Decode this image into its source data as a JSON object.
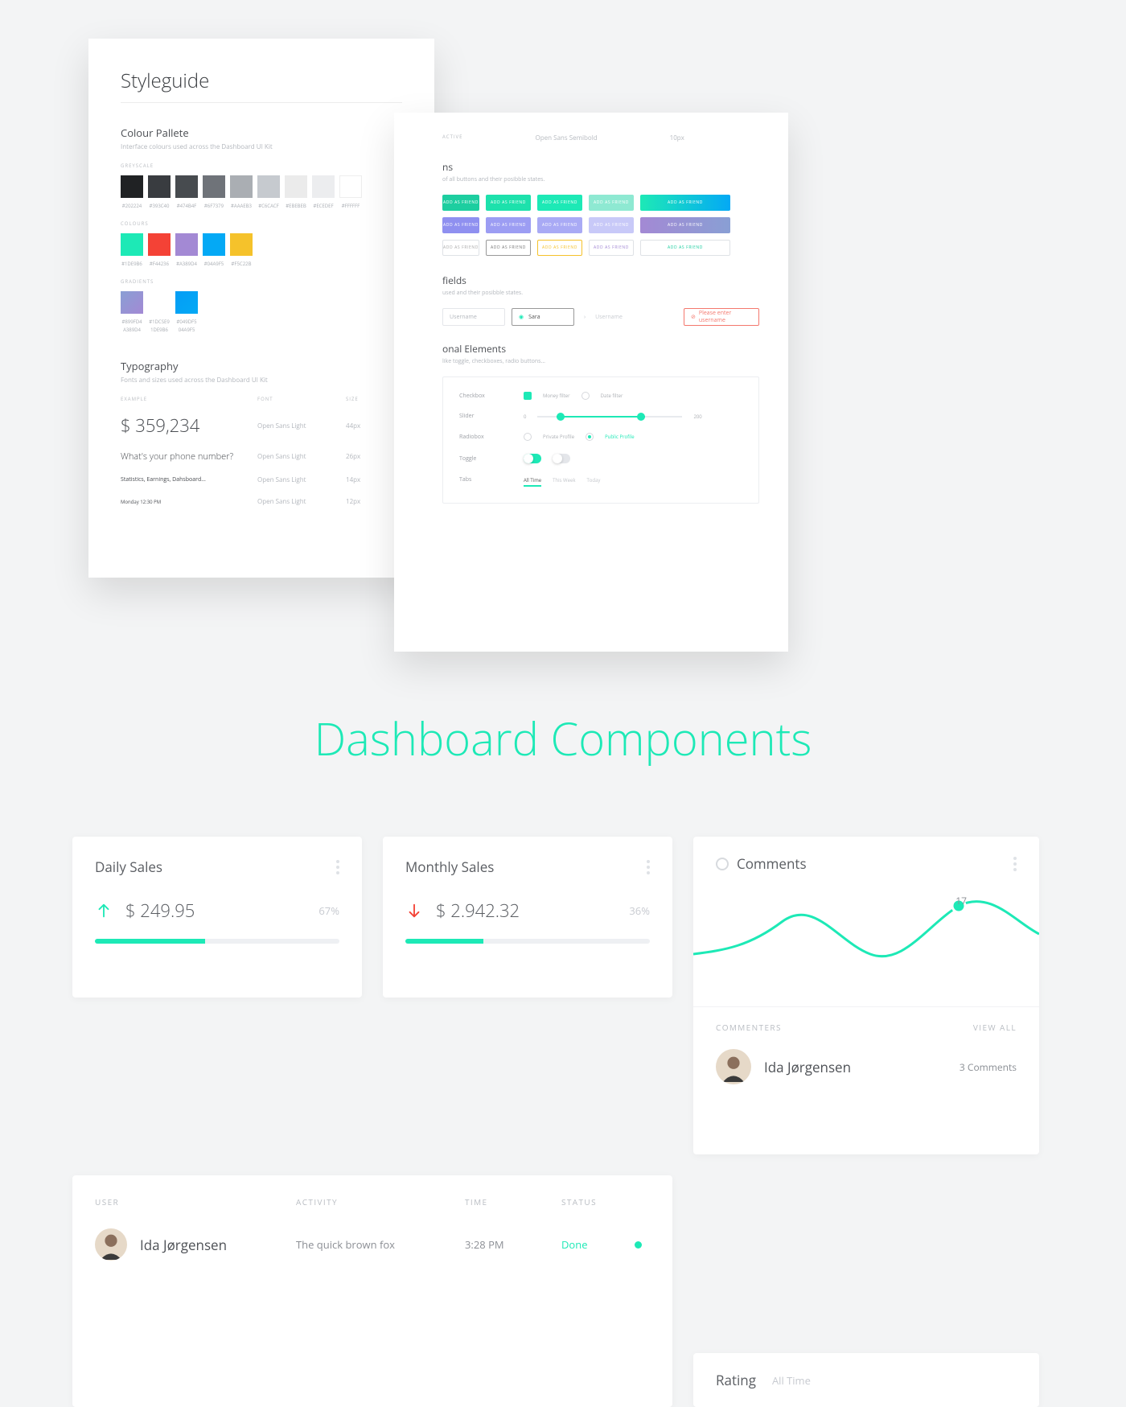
{
  "styleguide": {
    "title": "Styleguide",
    "palette": {
      "heading": "Colour Pallete",
      "sub": "Interface colours used across the Dashboard UI Kit",
      "greyscale_label": "GREYSCALE",
      "greyscale": [
        {
          "hex": "#202224"
        },
        {
          "hex": "#393C40"
        },
        {
          "hex": "#474B4F"
        },
        {
          "hex": "#6F7379"
        },
        {
          "hex": "#AAAEB3"
        },
        {
          "hex": "#C6CACF"
        },
        {
          "hex": "#EBEBEB"
        },
        {
          "hex": "#ECEDEF"
        },
        {
          "hex": "#FFFFFF"
        }
      ],
      "colours_label": "COLOURS",
      "colours": [
        {
          "hex": "#1DE9B6"
        },
        {
          "hex": "#F44236"
        },
        {
          "hex": "#A389D4"
        },
        {
          "hex": "#04A9F5"
        },
        {
          "hex": "#F5C22B"
        }
      ],
      "gradients_label": "GRADIENTS",
      "gradients": [
        {
          "a": "#899FD4",
          "b": "#A389D4",
          "lab1": "#899FD4",
          "lab2": "A389D4"
        },
        {
          "a": "#1DCSE9",
          "b": "#1DE9B6",
          "lab1": "#1DCSE9",
          "lab2": "1DE9B6"
        },
        {
          "a": "#049DF5",
          "b": "#04A9F5",
          "lab1": "#049DF5",
          "lab2": "04A9F5"
        }
      ]
    },
    "typography": {
      "heading": "Typography",
      "sub": "Fonts and sizes used across the Dashboard UI Kit",
      "cols": {
        "example": "EXAMPLE",
        "font": "FONT",
        "size": "SIZE"
      },
      "rows": [
        {
          "example": "$ 359,234",
          "font": "Open Sans Light",
          "size": "44px",
          "fs": "22px",
          "fw": "300"
        },
        {
          "example": "What's your phone number?",
          "font": "Open Sans Light",
          "size": "26px",
          "fs": "11px",
          "fw": "300"
        },
        {
          "example": "Statistics, Earnings, Dahsboard...",
          "font": "Open Sans Light",
          "size": "14px",
          "fs": "7px",
          "fw": "400"
        },
        {
          "example": "Monday 12:30 PM",
          "font": "Open Sans Light",
          "size": "12px",
          "fs": "6px",
          "fw": "400"
        }
      ]
    }
  },
  "sheet": {
    "top": {
      "label": "ACTIVE",
      "font": "Open Sans Semibold",
      "size": "10px"
    },
    "buttons": {
      "heading": "ns",
      "sub": "of all buttons and their posibble states.",
      "label": "ADD AS FRIEND"
    },
    "fields": {
      "heading": "fields",
      "sub": "used and their posibble states.",
      "ph": "Username",
      "val": "Sara",
      "err": "Please enter username"
    },
    "elements": {
      "heading": "onal Elements",
      "sub": "like toggle, checkboxes, radio buttons...",
      "checkbox": "Checkbox",
      "slider": "Slider",
      "radiobox": "Radiobox",
      "toggle": "Toggle",
      "tabs": "Tabs",
      "chk_on": "Money filter",
      "chk_off": "Date filter",
      "rad1": "Private Profile",
      "rad2": "Public Profile",
      "tabs_items": [
        "All Time",
        "This Week",
        "Today"
      ],
      "slider_min": "0",
      "slider_max": "200"
    }
  },
  "headline": "Dashboard Components",
  "daily": {
    "title": "Daily Sales",
    "amount": "$ 249.95",
    "pct": "67%",
    "bar": 45
  },
  "monthly": {
    "title": "Monthly Sales",
    "amount": "$ 2.942.32",
    "pct": "36%",
    "bar": 32
  },
  "comments": {
    "title": "Comments",
    "point": "17",
    "commenters_label": "COMMENTERS",
    "viewall": "VIEW ALL",
    "user": {
      "name": "Ida Jørgensen",
      "count": "3 Comments"
    }
  },
  "table": {
    "cols": {
      "user": "USER",
      "activity": "ACTIVITY",
      "time": "TIME",
      "status": "STATUS"
    },
    "rows": [
      {
        "user": "Ida Jørgensen",
        "activity": "The quick brown fox",
        "time": "3:28 PM",
        "status": "Done"
      }
    ]
  },
  "rating": {
    "title": "Rating",
    "sub": "All Time"
  },
  "chart_data": {
    "type": "line",
    "title": "Comments",
    "x": [
      0,
      1,
      2,
      3,
      4,
      5,
      6,
      7
    ],
    "values": [
      8,
      9,
      14,
      11,
      9,
      13,
      17,
      15
    ],
    "highlight": {
      "x": 6,
      "value": 17
    },
    "ylim": [
      0,
      20
    ]
  }
}
